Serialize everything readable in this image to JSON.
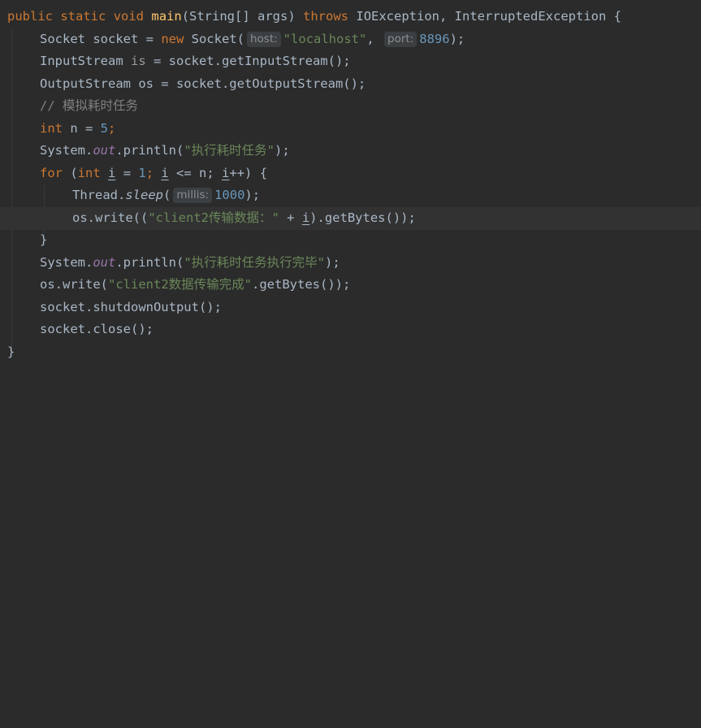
{
  "editor": {
    "line1": {
      "kw_public": "public",
      "kw_static": "static",
      "kw_void": "void",
      "method_name": "main",
      "params": "(String[] args)",
      "kw_throws": "throws",
      "exceptions": "IOException, InterruptedException {"
    },
    "line2": {
      "lhs": "Socket socket = ",
      "kw_new": "new",
      "ctor": " Socket(",
      "hint_host": "host:",
      "host_value": "\"localhost\"",
      "comma": ",",
      "hint_port": "port:",
      "port_value": "8896",
      "close": ");"
    },
    "line3": {
      "type": "InputStream ",
      "var": "is",
      "rest": " = socket.getInputStream();"
    },
    "line4": {
      "text": "OutputStream os = socket.getOutputStream();"
    },
    "line5": {
      "comment": "// 模拟耗时任务"
    },
    "line6": {
      "kw_int": "int",
      "mid": " n = ",
      "num": "5",
      "semi": ";"
    },
    "line7": {
      "prefix": "System.",
      "static_field": "out",
      "mid": ".println(",
      "str": "\"执行耗时任务\"",
      "close": ");"
    },
    "line8": {
      "kw_for": "for",
      "open": " (",
      "kw_int": "int",
      "sp": " ",
      "var1": "i",
      "eq": " = ",
      "one": "1",
      "semi1": "; ",
      "var2": "i",
      "cond": " <= n; ",
      "var3": "i",
      "inc": "++) {"
    },
    "line9": {
      "prefix": "Thread.",
      "method": "sleep",
      "open": "(",
      "hint_millis": "millis:",
      "value": "1000",
      "close": ");"
    },
    "line10": {
      "prefix": "os.write((",
      "str": "\"client2传输数据：\"",
      "plus": " + ",
      "var": "i",
      "rest": ").getBytes());"
    },
    "line11": {
      "text": "}"
    },
    "line12": {
      "prefix": "System.",
      "static_field": "out",
      "mid": ".println(",
      "str": "\"执行耗时任务执行完毕\"",
      "close": ");"
    },
    "line13": {
      "prefix": "os.write(",
      "str": "\"client2数据传输完成\"",
      "rest": ".getBytes());"
    },
    "line14": {
      "text": "socket.shutdownOutput();"
    },
    "line15": {
      "text": "socket.close();"
    },
    "line16": {
      "text": "}"
    }
  },
  "colors": {
    "background": "#2b2b2b",
    "current_line": "#323232",
    "keyword": "#cc7832",
    "method_declaration": "#ffc66d",
    "string": "#6a8759",
    "number": "#6897bb",
    "comment": "#808080",
    "static_field": "#9876aa",
    "default_text": "#a9b7c6",
    "inlay_hint_bg": "#3b3f41",
    "inlay_hint_text": "#8a8f93"
  }
}
